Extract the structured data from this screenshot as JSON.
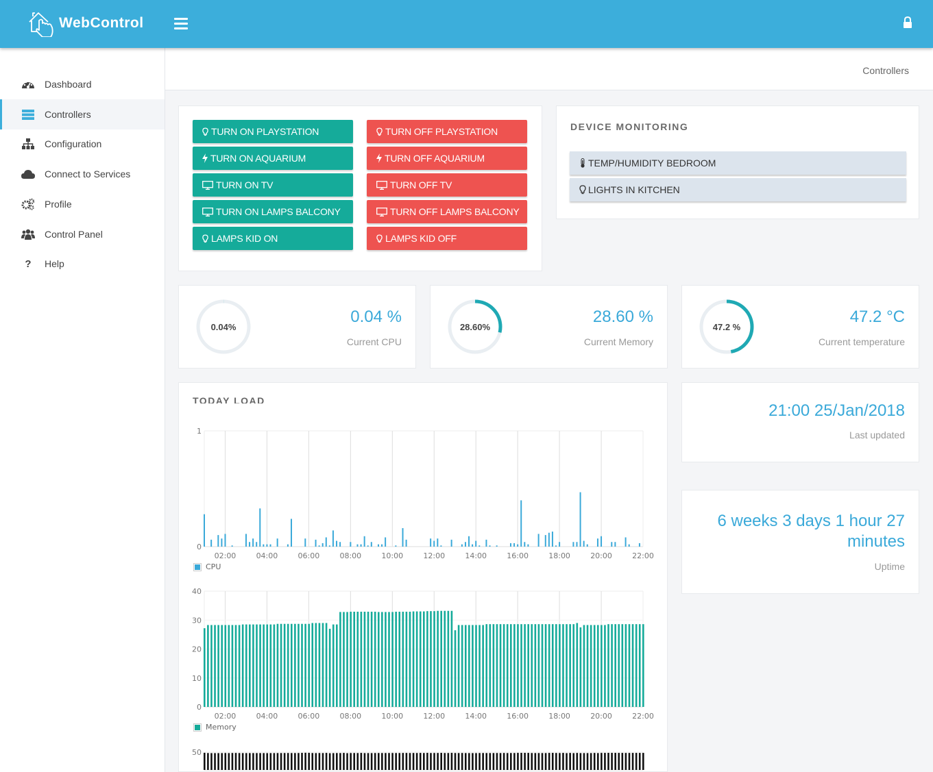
{
  "app": {
    "title": "WebControl",
    "logo_icon": "house-hand-icon",
    "menu_icon": "hamburger-icon",
    "lock_icon": "lock-icon"
  },
  "colors": {
    "header": "#3caedb",
    "on_button": "#15ab9a",
    "off_button": "#ee5350",
    "accent_text": "#3aa9d9",
    "ring": "#1fa9b4",
    "cpu": "#3aa9d9",
    "memory": "#15ab9a",
    "third": "#111111"
  },
  "sidebar": {
    "items": [
      {
        "label": "Dashboard",
        "icon": "dashboard-icon"
      },
      {
        "label": "Controllers",
        "icon": "server-icon",
        "active": true
      },
      {
        "label": "Configuration",
        "icon": "sitemap-icon"
      },
      {
        "label": "Connect to Services",
        "icon": "cloud-icon"
      },
      {
        "label": "Profile",
        "icon": "cogs-icon"
      },
      {
        "label": "Control Panel",
        "icon": "users-icon"
      },
      {
        "label": "Help",
        "icon": "question-icon"
      }
    ]
  },
  "breadcrumb": "Controllers",
  "controls": {
    "on": [
      {
        "label": "TURN ON PLAYSTATION",
        "icon": "lightbulb-icon"
      },
      {
        "label": "TURN ON AQUARIUM",
        "icon": "bolt-icon"
      },
      {
        "label": "TURN ON TV",
        "icon": "monitor-icon"
      },
      {
        "label": "TURN ON LAMPS BALCONY",
        "icon": "monitor-icon"
      },
      {
        "label": "LAMPS KID ON",
        "icon": "lightbulb-icon"
      }
    ],
    "off": [
      {
        "label": "TURN OFF PLAYSTATION",
        "icon": "lightbulb-icon"
      },
      {
        "label": "TURN OFF AQUARIUM",
        "icon": "bolt-icon"
      },
      {
        "label": "TURN OFF TV",
        "icon": "monitor-icon"
      },
      {
        "label": "TURN OFF LAMPS BALCONY",
        "icon": "monitor-icon"
      },
      {
        "label": "LAMPS KID OFF",
        "icon": "lightbulb-icon"
      }
    ]
  },
  "device_monitoring": {
    "title": "DEVICE MONITORING",
    "items": [
      {
        "label": "TEMP/HUMIDITY BEDROOM",
        "icon": "thermometer-icon"
      },
      {
        "label": "LIGHTS IN KITCHEN",
        "icon": "lightbulb-icon"
      }
    ]
  },
  "stats": [
    {
      "ring_text": "0.04%",
      "value": "0.04 %",
      "label": "Current CPU",
      "percent": 0.04
    },
    {
      "ring_text": "28.60%",
      "value": "28.60 %",
      "label": "Current Memory",
      "percent": 28.6
    },
    {
      "ring_text": "47.2 %",
      "value": "47.2 °C",
      "label": "Current temperature",
      "percent": 47.2
    }
  ],
  "last_updated": {
    "value": "21:00 25/Jan/2018",
    "label": "Last updated"
  },
  "uptime": {
    "value_line1": "6 weeks 3 days 1 hour 27",
    "value_line2": "minutes",
    "label": "Uptime"
  },
  "load_title": "TODAY LOAD",
  "chart_data": [
    {
      "type": "bar",
      "name": "CPU",
      "legend": "bottom-left",
      "grid": true,
      "x_start": "01:00",
      "x_interval_minutes": 10,
      "xticks": [
        "02:00",
        "04:00",
        "06:00",
        "08:00",
        "10:00",
        "12:00",
        "14:00",
        "16:00",
        "18:00",
        "20:00",
        "22:00"
      ],
      "yticks": [
        "0",
        "1"
      ],
      "ylim": [
        0,
        1
      ],
      "values": [
        0.28,
        0,
        0.06,
        0,
        0.1,
        0.07,
        0.11,
        0,
        0.01,
        0,
        0,
        0,
        0.11,
        0.04,
        0.07,
        0.04,
        0.33,
        0.02,
        0.02,
        0.02,
        0,
        0.07,
        0,
        0,
        0.02,
        0.24,
        0,
        0,
        0,
        0.07,
        0,
        0,
        0.06,
        0.01,
        0.03,
        0.08,
        0.01,
        0.14,
        0.05,
        0.04,
        0,
        0,
        0.04,
        0,
        0.02,
        0.02,
        0.09,
        0.01,
        0.04,
        0,
        0.02,
        0.02,
        0.08,
        0,
        0,
        0.01,
        0,
        0.16,
        0.06,
        0,
        0,
        0,
        0,
        0,
        0,
        0.07,
        0.05,
        0.07,
        0.01,
        0,
        0,
        0.06,
        0,
        0,
        0.02,
        0.04,
        0.09,
        0.02,
        0.05,
        0.01,
        0,
        0.06,
        0.01,
        0,
        0.01,
        0,
        0,
        0,
        0.03,
        0.03,
        0.02,
        0.4,
        0.04,
        0.02,
        0,
        0,
        0.11,
        0,
        0.1,
        0.12,
        0.13,
        0.01,
        0.04,
        0,
        0,
        0,
        0.04,
        0.04,
        0.47,
        0.05,
        0.02,
        0,
        0,
        0.07,
        0.09,
        0,
        0,
        0.04,
        0.04,
        0,
        0,
        0.08,
        0.02,
        0,
        0,
        0.03,
        0
      ]
    },
    {
      "type": "bar",
      "name": "Memory",
      "legend": "bottom-left",
      "grid": true,
      "x_start": "01:00",
      "x_interval_minutes": 10,
      "xticks": [
        "02:00",
        "04:00",
        "06:00",
        "08:00",
        "10:00",
        "12:00",
        "14:00",
        "16:00",
        "18:00",
        "20:00",
        "22:00"
      ],
      "yticks": [
        "0",
        "10",
        "20",
        "30",
        "40"
      ],
      "ylim": [
        0,
        40
      ],
      "values": [
        27.2,
        28.3,
        28.3,
        28.3,
        28.3,
        28.3,
        28.3,
        28.3,
        28.3,
        28.3,
        28.3,
        28.5,
        28.5,
        28.5,
        28.5,
        28.5,
        28.5,
        28.5,
        28.5,
        28.5,
        28.5,
        28.7,
        28.7,
        28.7,
        28.7,
        28.7,
        28.7,
        28.7,
        28.7,
        28.7,
        28.7,
        29.0,
        29.0,
        29.0,
        29.0,
        29.0,
        27.0,
        28.5,
        28.5,
        32.8,
        32.8,
        32.8,
        32.9,
        32.9,
        32.9,
        32.9,
        32.9,
        32.9,
        32.9,
        32.9,
        32.8,
        32.8,
        32.8,
        32.8,
        32.8,
        32.9,
        32.9,
        32.9,
        32.9,
        32.9,
        33.0,
        33.0,
        33.0,
        33.0,
        33.1,
        33.1,
        33.1,
        33.2,
        33.2,
        33.2,
        33.2,
        33.2,
        26.5,
        28.3,
        28.3,
        28.3,
        28.3,
        28.3,
        28.3,
        28.3,
        28.3,
        28.6,
        28.6,
        28.6,
        28.6,
        28.6,
        28.6,
        28.6,
        28.6,
        28.6,
        28.6,
        28.6,
        28.6,
        28.6,
        28.6,
        28.6,
        28.6,
        28.6,
        28.6,
        28.6,
        28.6,
        28.6,
        28.6,
        28.6,
        28.6,
        28.6,
        28.6,
        29.0,
        27.5,
        28.3,
        28.3,
        28.3,
        28.3,
        28.3,
        28.3,
        28.3,
        28.6,
        28.6,
        28.6,
        28.6,
        28.6,
        28.6,
        28.6,
        28.6,
        28.6,
        28.6,
        28.6
      ]
    },
    {
      "type": "bar",
      "grid": true,
      "x_start": "01:00",
      "x_interval_minutes": 10,
      "yticks": [
        "50"
      ],
      "ylim": [
        0,
        50
      ],
      "values": [
        48.2,
        47.5,
        47.3,
        47.3,
        47.3,
        47.4,
        47.6,
        47.4,
        47.7,
        47.8,
        47.5,
        47.4,
        47.4,
        47.4,
        47.4,
        47.4,
        47.4,
        47.4,
        47.2,
        47.4,
        47.4,
        47.5,
        47.5,
        47.6,
        47.6,
        47.5,
        47.5,
        47.6,
        48.0,
        48.3,
        48.0,
        47.6,
        47.4,
        47.6,
        47.5,
        47.9,
        47.1,
        47.3,
        47.5,
        47.5,
        47.9,
        47.2,
        47.5,
        47.6,
        47.5,
        47.9,
        47.4,
        47.4,
        47.4,
        47.6,
        47.6,
        47.6,
        47.6,
        47.6,
        47.6,
        47.6,
        47.6,
        47.8,
        47.8,
        47.6,
        47.7,
        47.6,
        47.9,
        47.6,
        48.0,
        47.6,
        47.6,
        47.7,
        48.0,
        47.6,
        47.6,
        48.0,
        47.6,
        47.5,
        47.7,
        47.5,
        47.4,
        47.4,
        47.3,
        47.6,
        47.6,
        47.5,
        47.5,
        47.5,
        47.6,
        47.5,
        47.7,
        47.5,
        47.6,
        47.6,
        47.9,
        48.0,
        48.0,
        47.9,
        47.6,
        47.5,
        47.5,
        47.5,
        47.5,
        47.9,
        48.0,
        47.7,
        47.5,
        47.9,
        47.3,
        47.8,
        47.3,
        47.8,
        47.4,
        47.4,
        47.4,
        47.4,
        47.8,
        47.4,
        47.8,
        47.9,
        48.0,
        48.0,
        48.0,
        47.9,
        47.9,
        47.8,
        47.8,
        47.9,
        47.9,
        47.9,
        47.9
      ]
    }
  ]
}
